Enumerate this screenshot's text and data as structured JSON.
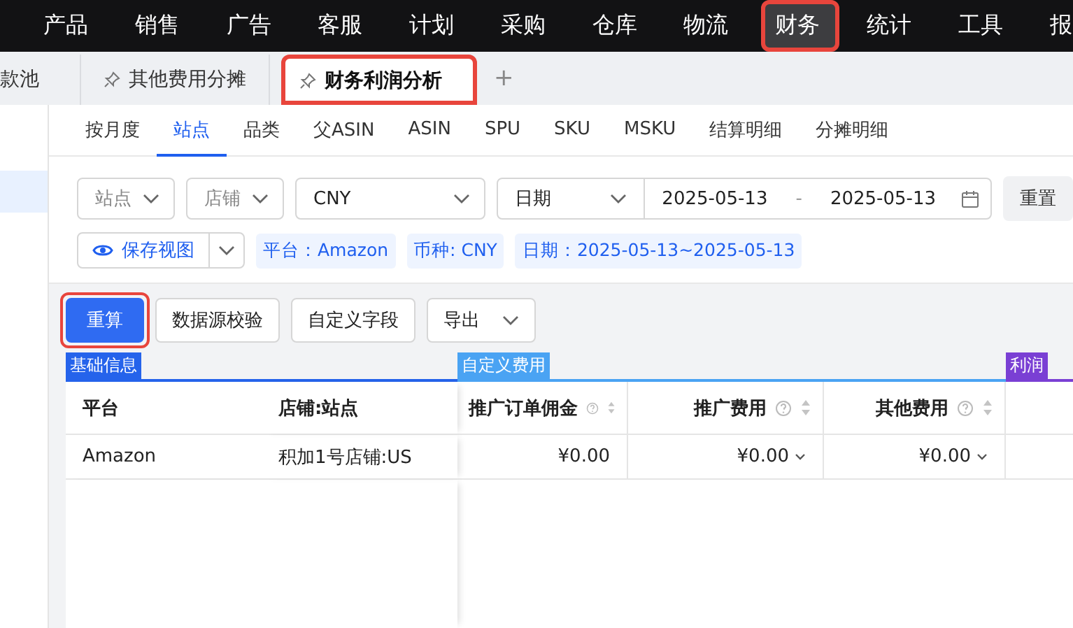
{
  "nav": {
    "items": [
      {
        "label": "产品",
        "selected": false,
        "highlighted": false
      },
      {
        "label": "销售",
        "selected": false,
        "highlighted": false
      },
      {
        "label": "广告",
        "selected": false,
        "highlighted": false
      },
      {
        "label": "客服",
        "selected": false,
        "highlighted": false
      },
      {
        "label": "计划",
        "selected": false,
        "highlighted": false
      },
      {
        "label": "采购",
        "selected": false,
        "highlighted": false
      },
      {
        "label": "仓库",
        "selected": false,
        "highlighted": false
      },
      {
        "label": "物流",
        "selected": false,
        "highlighted": false
      },
      {
        "label": "财务",
        "selected": true,
        "highlighted": true
      },
      {
        "label": "统计",
        "selected": false,
        "highlighted": false
      },
      {
        "label": "工具",
        "selected": false,
        "highlighted": false
      },
      {
        "label": "报",
        "selected": false,
        "highlighted": false
      }
    ]
  },
  "page_tabs": [
    {
      "label": "款池",
      "selected": false,
      "pinned": false,
      "highlighted": false
    },
    {
      "label": "其他费用分摊",
      "selected": false,
      "pinned": true,
      "highlighted": false
    },
    {
      "label": "财务利润分析",
      "selected": true,
      "pinned": true,
      "highlighted": true
    }
  ],
  "add_tab": "+",
  "view_tabs": [
    {
      "label": "按月度",
      "selected": false
    },
    {
      "label": "站点",
      "selected": true
    },
    {
      "label": "品类",
      "selected": false
    },
    {
      "label": "父ASIN",
      "selected": false
    },
    {
      "label": "ASIN",
      "selected": false
    },
    {
      "label": "SPU",
      "selected": false
    },
    {
      "label": "SKU",
      "selected": false
    },
    {
      "label": "MSKU",
      "selected": false
    },
    {
      "label": "结算明细",
      "selected": false
    },
    {
      "label": "分摊明细",
      "selected": false
    }
  ],
  "filters": {
    "site": {
      "placeholder": "站点"
    },
    "store": {
      "placeholder": "店铺"
    },
    "currency": {
      "value": "CNY"
    },
    "date_type": {
      "value": "日期"
    },
    "date_start": {
      "value": "2025-05-13"
    },
    "date_separator": "-",
    "date_end": {
      "value": "2025-05-13"
    },
    "reset": "重置"
  },
  "save_view": "保存视图",
  "filter_tags": [
    "平台：Amazon",
    "币种: CNY",
    "日期：2025-05-13~2025-05-13"
  ],
  "actions": [
    {
      "label": "重算",
      "kind": "primary",
      "highlighted": true
    },
    {
      "label": "数据源校验",
      "kind": "default",
      "highlighted": false
    },
    {
      "label": "自定义字段",
      "kind": "default",
      "highlighted": false
    },
    {
      "label": "导出",
      "kind": "dropdown",
      "highlighted": false
    }
  ],
  "table": {
    "groups": [
      {
        "label": "基础信息",
        "color": "#2563eb"
      },
      {
        "label": "自定义费用",
        "color": "#4aa3f3"
      },
      {
        "label": "利润",
        "color": "#7a3fd4"
      }
    ],
    "columns": [
      {
        "label": "平台",
        "kind": "text"
      },
      {
        "label": "店铺:站点",
        "kind": "text"
      },
      {
        "label": "推广订单佣金",
        "kind": "amount"
      },
      {
        "label": "推广费用",
        "kind": "amount"
      },
      {
        "label": "其他费用",
        "kind": "amount"
      }
    ],
    "rows": [
      {
        "cells": [
          {
            "text": "Amazon",
            "expandable": false
          },
          {
            "text": "积加1号店铺:US",
            "expandable": false
          },
          {
            "text": "¥0.00",
            "expandable": false
          },
          {
            "text": "¥0.00",
            "expandable": true
          },
          {
            "text": "¥0.00",
            "expandable": true
          }
        ]
      }
    ]
  }
}
